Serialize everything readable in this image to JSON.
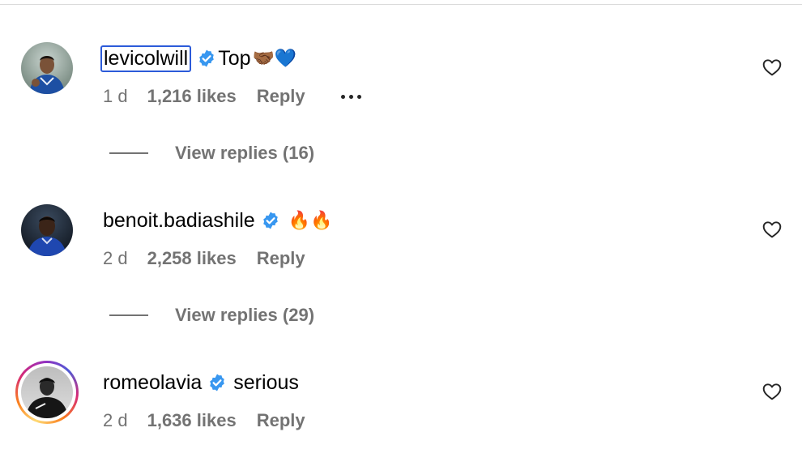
{
  "comments": [
    {
      "username": "levicolwill",
      "verified": true,
      "text": "Top",
      "emoji": "🤝🏾💙",
      "time": "1 d",
      "likes": "1,216 likes",
      "reply_label": "Reply",
      "avatar_icon": "player-photo-avatar",
      "view_replies": "View replies (16)"
    },
    {
      "username": "benoit.badiashile",
      "verified": true,
      "text": "",
      "emoji": "🔥🔥",
      "time": "2 d",
      "likes": "2,258 likes",
      "reply_label": "Reply",
      "avatar_icon": "player-photo-avatar",
      "view_replies": "View replies (29)"
    },
    {
      "username": "romeolavia",
      "verified": true,
      "text": "serious",
      "emoji": "",
      "time": "2 d",
      "likes": "1,636 likes",
      "reply_label": "Reply",
      "avatar_icon": "story-ring-avatar"
    }
  ],
  "colors": {
    "verified": "#3897f0",
    "muted_text": "#737373",
    "focus_outline": "#2c5bd9",
    "story_ring": [
      "#feda75",
      "#fa7e1e",
      "#d62976",
      "#962fbf",
      "#4f5bd5"
    ]
  }
}
